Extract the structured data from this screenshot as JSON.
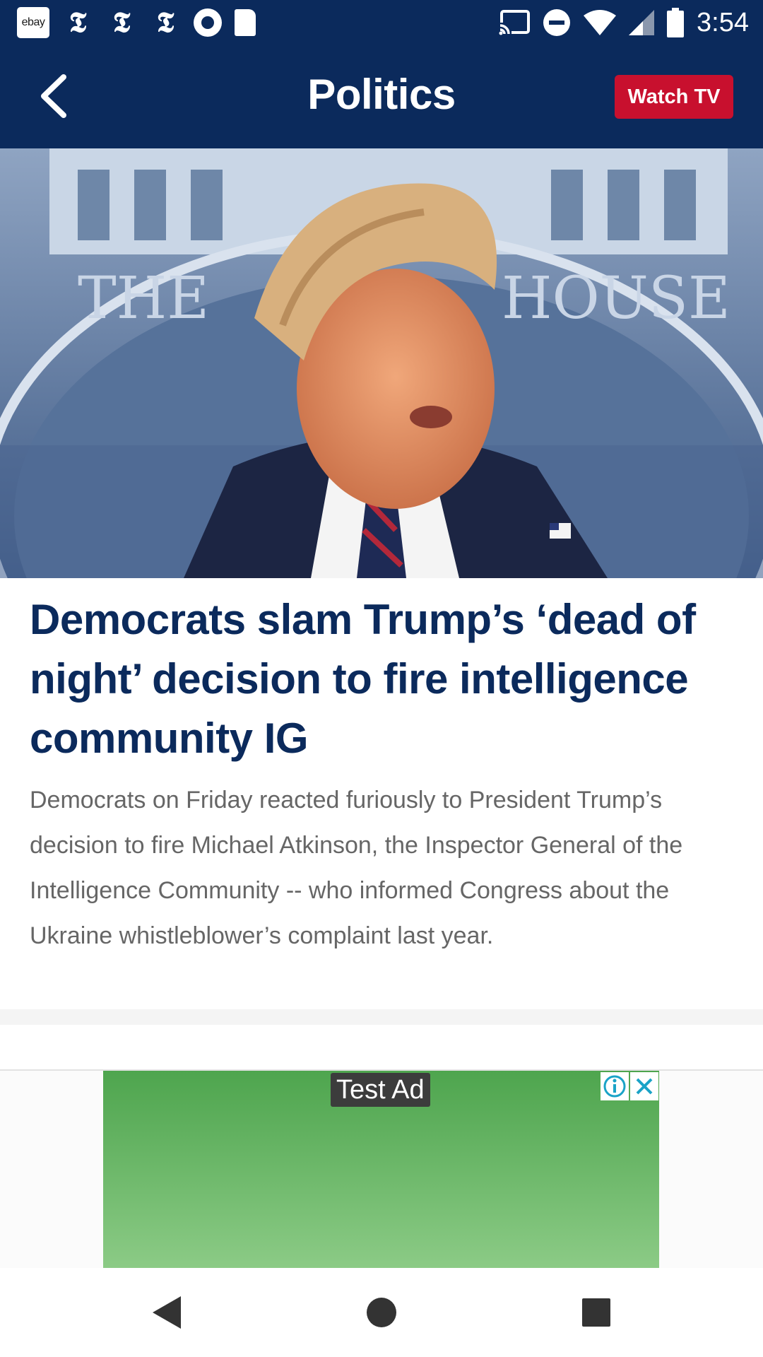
{
  "status_bar": {
    "time": "3:54",
    "left_icons": [
      "ebay-app-icon",
      "nytimes-icon",
      "nytimes-icon",
      "nytimes-icon",
      "record-icon",
      "sd-card-icon"
    ],
    "ebay_label": "ebay",
    "nyt_glyph": "𝕿",
    "right_icons": [
      "cast-icon",
      "do-not-disturb-icon",
      "wifi-icon",
      "signal-icon",
      "battery-icon"
    ]
  },
  "app_bar": {
    "title": "Politics",
    "watch_tv_label": "Watch TV",
    "back_icon": "chevron-left-icon"
  },
  "article": {
    "hero_image": "press-briefing-photo",
    "headline": "Democrats slam Trump’s ‘dead of night’ decision to fire intelligence community IG",
    "summary": "Democrats on Friday reacted furiously to President Trump’s decision to fire Michael Atkinson, the Inspector General of the Intelligence Community -- who informed Congress about the Ukraine whistleblower’s complaint last year."
  },
  "ad": {
    "label": "Test Ad",
    "info_icon": "info-icon",
    "close_icon": "close-icon"
  },
  "nav_bar": {
    "buttons": [
      "back-triangle-icon",
      "home-circle-icon",
      "recents-square-icon"
    ]
  },
  "colors": {
    "brand_navy": "#0b2a5c",
    "watch_red": "#c8102e",
    "ad_green": "#5fb05f"
  }
}
